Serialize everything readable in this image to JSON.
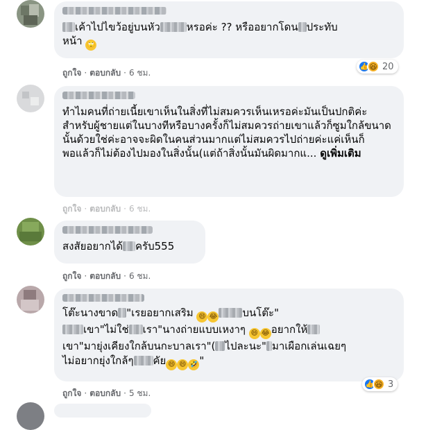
{
  "comments": [
    {
      "text_lines": [
        "เค้าไปไขว้อยู่บนหัว",
        "หรอค่ะ ?? หรืออยากโดน",
        "ประทับ",
        "หน้า"
      ],
      "emoji_end": "🙄",
      "actions": {
        "like": "ถูกใจ",
        "reply": "ตอบกลับ",
        "time": "6 ชม."
      },
      "reactions": {
        "count": "20"
      }
    },
    {
      "text": "ทำไมคนที่ถ่ายเนี้ยเขาเห็นในสิ่งที่ไม่สมควรเห็นเหรอค่ะมันเป็นปกติค่ะสำหรับผู้ชายแต่ในบางทีหรือบางครั้งก็ไม่สมควรถ่ายเขาแล้วก็ซูมใกล้ขนาดนั้นด้วยใช่ค่ะอาจจะผิดในคนส่วนมากแต่ไม่สมควรไปถ่ายค่ะแค่เห็นก็พอแล้วก็ไม่ต้องไปมองในสิ่งนั้น(แต่ถ้าสิ่งนั้นมันผิดมากแ...",
      "see_more": "ดูเพิ่มเติม",
      "actions": {
        "like": "ถูกใจ",
        "reply": "ตอบกลับ",
        "time": "6 ชม."
      }
    },
    {
      "text_a": "สงสัยอยากได้",
      "text_b": "ครับ555",
      "actions": {
        "like": "ถูกใจ",
        "reply": "ตอบกลับ",
        "time": "6 ชม."
      }
    },
    {
      "line1_a": "โต๊ะนางขาด",
      "line1_b": "\"เรยอยากเสริม",
      "line1_c": "บนโต๊ะ\"",
      "line2_a": "เขา\"ไม่ใช่",
      "line2_b": "เรา\"นางถ่ายแบบเหงาๆ",
      "line2_c": "อยากให้",
      "line3_a": "เขา\"มายุ่งเคียงใกล้บนกะบาลเรา\"(",
      "line3_b": "ไปละนะ\"",
      "line3_c": "มาเผือกเล่นเฉยๆ",
      "line4_a": "ไม่อยากยุ่งใกล้ๆ",
      "line4_b": "คัย",
      "line4_c": "\"",
      "actions": {
        "like": "ถูกใจ",
        "reply": "ตอบกลับ",
        "time": "5 ชม."
      },
      "reactions": {
        "count": "3"
      }
    }
  ],
  "icons": {
    "like": "like-reaction-icon",
    "haha": "haha-reaction-icon"
  },
  "colors": {
    "bubble": "#f0f2f5",
    "meta": "#65676b",
    "like": "#1877f2",
    "haha": "#f7b125"
  }
}
